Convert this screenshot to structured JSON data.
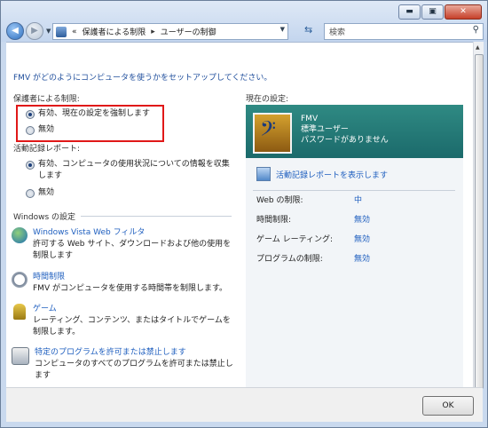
{
  "window": {
    "minimize": "▬",
    "maximize": "▣",
    "close": "✕"
  },
  "address": {
    "prefix": "«",
    "segment1": "保護者による制限",
    "arrow": "▸",
    "segment2": "ユーザーの制御"
  },
  "search": {
    "placeholder": "検索"
  },
  "intro": "FMV がどのようにコンピュータを使うかをセットアップしてください。",
  "parental": {
    "heading": "保護者による制限:",
    "on_label": "有効、現在の設定を強制します",
    "off_label": "無効"
  },
  "activity": {
    "heading": "活動記録レポート:",
    "on_label": "有効、コンピュータの使用状況についての情報を収集します",
    "off_label": "無効"
  },
  "windows_settings": {
    "heading": "Windows の設定",
    "items": [
      {
        "link": "Windows Vista Web フィルタ",
        "desc": "許可する Web サイト、ダウンロードおよび他の使用を制限します"
      },
      {
        "link": "時間制限",
        "desc": "FMV がコンピュータを使用する時間帯を制限します。"
      },
      {
        "link": "ゲーム",
        "desc": "レーティング、コンテンツ、またはタイトルでゲームを制限します。"
      },
      {
        "link": "特定のプログラムを許可または禁止します",
        "desc": "コンピュータのすべてのプログラムを許可または禁止します"
      }
    ]
  },
  "current": {
    "heading": "現在の設定:",
    "user_name": "FMV",
    "user_type": "標準ユーザー",
    "user_password": "パスワードがありません",
    "report_link": "活動記録レポートを表示します",
    "rows": [
      {
        "label": "Web の制限:",
        "value": "中"
      },
      {
        "label": "時間制限:",
        "value": "無効"
      },
      {
        "label": "ゲーム レーティング:",
        "value": "無効"
      },
      {
        "label": "プログラムの制限:",
        "value": "無効"
      }
    ]
  },
  "ok_label": "OK"
}
